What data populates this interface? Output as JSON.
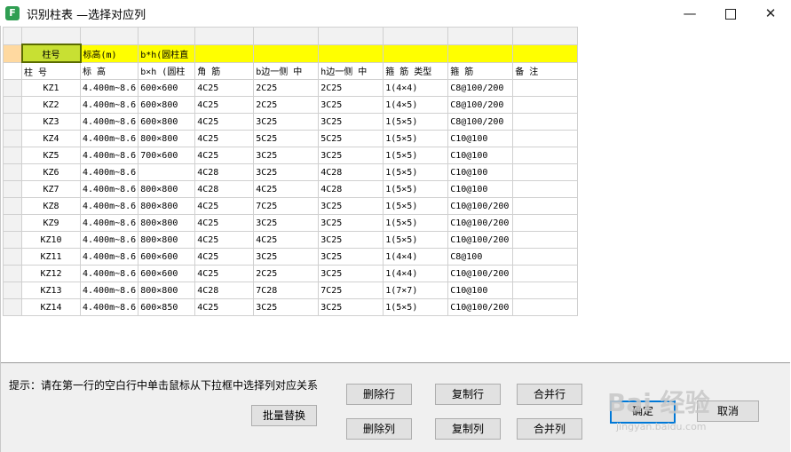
{
  "window": {
    "title": "识别柱表 —选择对应列",
    "icon_letter": "F",
    "minimize": "—",
    "close": "✕"
  },
  "selector_row": [
    "柱号",
    "标高(m)",
    "b*h(圆柱直",
    "",
    "",
    "",
    "",
    "",
    ""
  ],
  "column_names": [
    "柱 号",
    "标   高",
    "b×h (圆柱",
    "角  筋",
    "b边一侧 中",
    "h边一侧 中",
    "箍  筋 类型",
    "箍    筋",
    "备    注"
  ],
  "rows": [
    [
      "KZ1",
      "4.400m~8.6",
      "600×600",
      "4C25",
      "2C25",
      "2C25",
      "1(4×4)",
      "C8@100/200",
      ""
    ],
    [
      "KZ2",
      "4.400m~8.6",
      "600×800",
      "4C25",
      "2C25",
      "3C25",
      "1(4×5)",
      "C8@100/200",
      ""
    ],
    [
      "KZ3",
      "4.400m~8.6",
      "600×800",
      "4C25",
      "3C25",
      "3C25",
      "1(5×5)",
      "C8@100/200",
      ""
    ],
    [
      "KZ4",
      "4.400m~8.6",
      "800×800",
      "4C25",
      "5C25",
      "5C25",
      "1(5×5)",
      "C10@100",
      ""
    ],
    [
      "KZ5",
      "4.400m~8.6",
      "700×600",
      "4C25",
      "3C25",
      "3C25",
      "1(5×5)",
      "C10@100",
      ""
    ],
    [
      "KZ6",
      "4.400m~8.6",
      "",
      "4C28",
      "3C25",
      "4C28",
      "1(5×5)",
      "C10@100",
      ""
    ],
    [
      "KZ7",
      "4.400m~8.6",
      "800×800",
      "4C28",
      "4C25",
      "4C28",
      "1(5×5)",
      "C10@100",
      ""
    ],
    [
      "KZ8",
      "4.400m~8.6",
      "800×800",
      "4C25",
      "7C25",
      "3C25",
      "1(5×5)",
      "C10@100/200",
      ""
    ],
    [
      "KZ9",
      "4.400m~8.6",
      "800×800",
      "4C25",
      "3C25",
      "3C25",
      "1(5×5)",
      "C10@100/200",
      ""
    ],
    [
      "KZ10",
      "4.400m~8.6",
      "800×800",
      "4C25",
      "4C25",
      "3C25",
      "1(5×5)",
      "C10@100/200",
      ""
    ],
    [
      "KZ11",
      "4.400m~8.6",
      "600×600",
      "4C25",
      "3C25",
      "3C25",
      "1(4×4)",
      "C8@100",
      ""
    ],
    [
      "KZ12",
      "4.400m~8.6",
      "600×600",
      "4C25",
      "2C25",
      "3C25",
      "1(4×4)",
      "C10@100/200",
      ""
    ],
    [
      "KZ13",
      "4.400m~8.6",
      "800×800",
      "4C28",
      "7C28",
      "7C25",
      "1(7×7)",
      "C10@100",
      ""
    ],
    [
      "KZ14",
      "4.400m~8.6",
      "600×850",
      "4C25",
      "3C25",
      "3C25",
      "1(5×5)",
      "C10@100/200",
      ""
    ]
  ],
  "hint": "提示：请在第一行的空白行中单击鼠标从下拉框中选择列对应关系",
  "buttons": {
    "batch_replace": "批量替换",
    "delete_row": "删除行",
    "copy_row": "复制行",
    "merge_row": "合并行",
    "delete_col": "删除列",
    "copy_col": "复制列",
    "merge_col": "合并列",
    "ok": "确定",
    "cancel": "取消"
  },
  "watermark": {
    "text": "Bai 经验",
    "sub": "jingyan.baidu.com"
  },
  "colors": {
    "selector_yellow": "#ffff00",
    "active_cell": "#c8e033",
    "app_icon": "#2f9e52"
  }
}
